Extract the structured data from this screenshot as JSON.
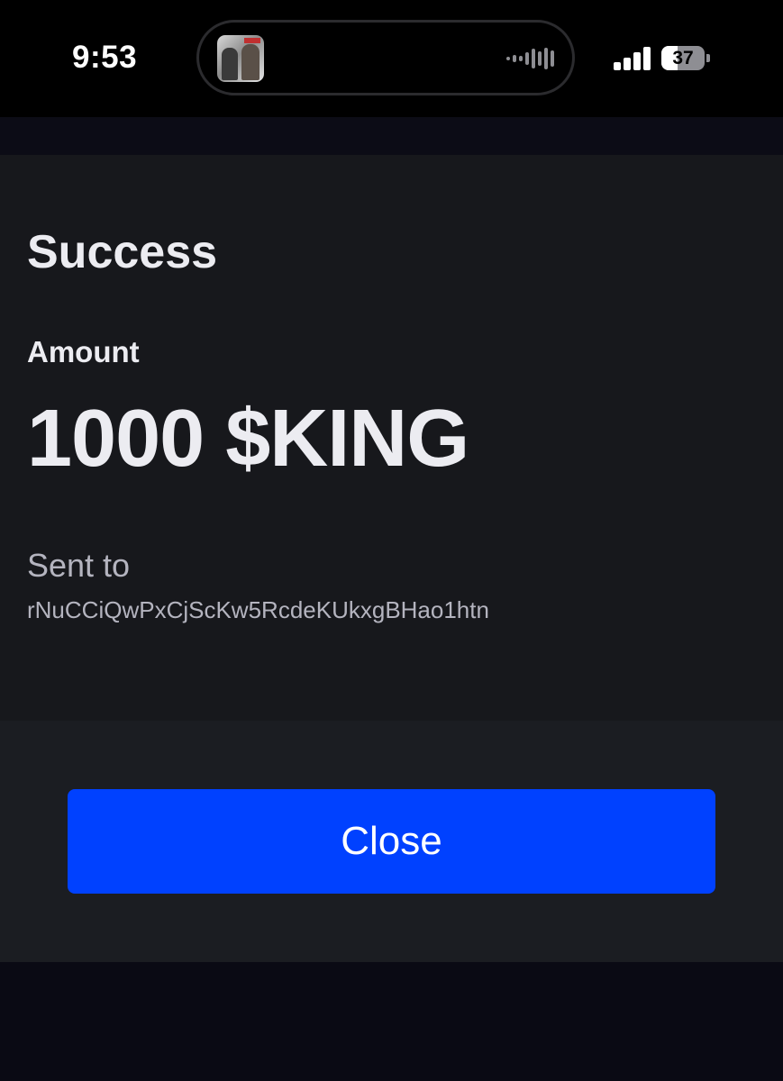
{
  "status_bar": {
    "time": "9:53",
    "battery_level": "37",
    "battery_fraction": 0.37,
    "icons": {
      "now_playing": "album-art-icon",
      "audio": "waveform-icon",
      "signal": "cellular-signal-icon",
      "battery": "battery-icon"
    }
  },
  "modal": {
    "title": "Success",
    "amount_label": "Amount",
    "amount_value": "1000 $KING",
    "sent_to_label": "Sent to",
    "recipient_address": "rNuCCiQwPxCjScKw5RcdeKUkxgBHao1htn",
    "close_label": "Close"
  },
  "colors": {
    "background": "#0a0a12",
    "modal_background": "#17181c",
    "footer_background": "#1b1d22",
    "primary_button": "#0041ff",
    "text_primary": "#ececf1",
    "text_secondary": "#b4b4bf"
  }
}
